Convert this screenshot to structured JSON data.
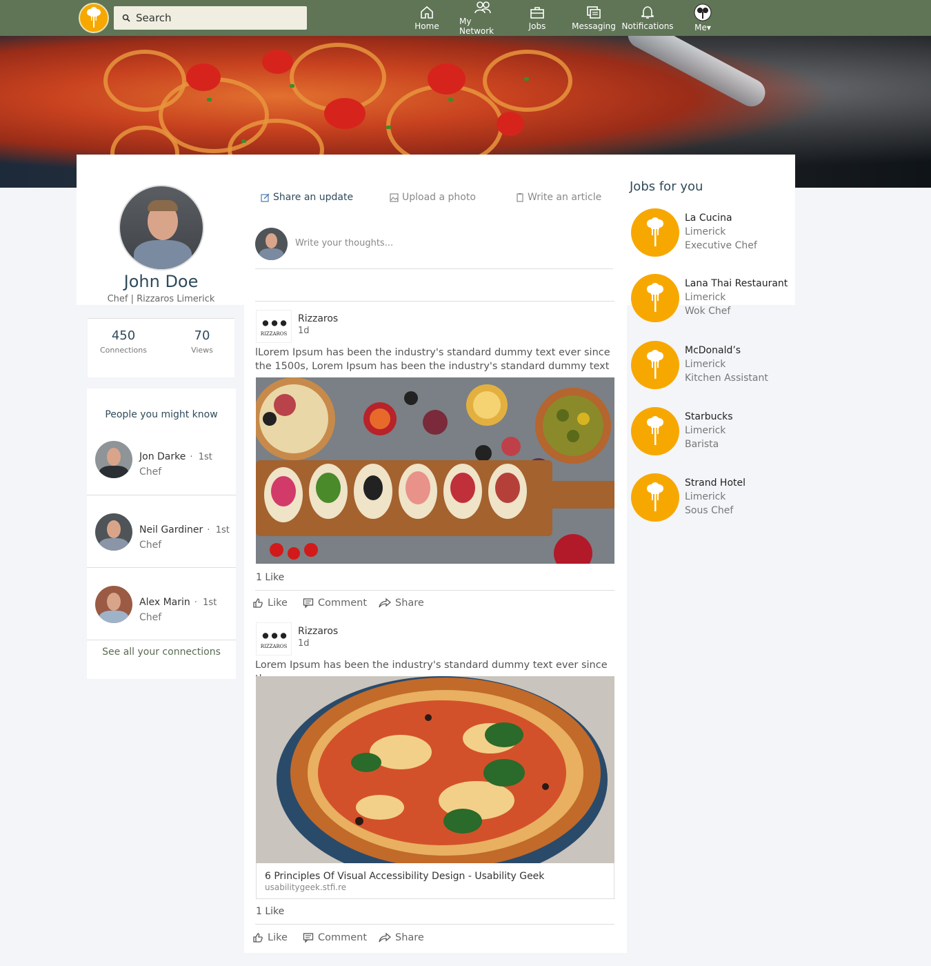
{
  "nav": {
    "search_placeholder": "Search",
    "items": [
      {
        "label": "Home",
        "icon": "home-icon"
      },
      {
        "label": "My Network",
        "icon": "network-icon"
      },
      {
        "label": "Jobs",
        "icon": "briefcase-icon"
      },
      {
        "label": "Messaging",
        "icon": "messaging-icon"
      },
      {
        "label": "Notifications",
        "icon": "bell-icon"
      },
      {
        "label": "Me",
        "icon": "avatar"
      }
    ]
  },
  "colors": {
    "nav_bg": "#5f7556",
    "accent": "#f7a800",
    "heading": "#2f4a5a"
  },
  "profile": {
    "name": "John Doe",
    "subtitle": "Chef | Rizzaros Limerick",
    "connections": "450",
    "connections_label": "Connections",
    "views": "70",
    "views_label": "Views"
  },
  "people": {
    "title": "People you might know",
    "items": [
      {
        "name": "Jon Darke",
        "degree": "1st",
        "role": "Chef"
      },
      {
        "name": "Neil Gardiner",
        "degree": "1st",
        "role": "Chef"
      },
      {
        "name": "Alex Marin",
        "degree": "1st",
        "role": "Chef"
      }
    ],
    "see_all": "See all your connections"
  },
  "composer": {
    "share_update": "Share an update",
    "upload_photo": "Upload a photo",
    "write_article": "Write an article",
    "placeholder": "Write your thoughts..."
  },
  "posts": [
    {
      "author": "Rizzaros",
      "logo_text": "RIZZAROS",
      "time": "1d",
      "text": "lLorem Ipsum has been the industry's standard dummy text ever since the 1500s,  Lorem Ipsum has been the industry's standard dummy text ever",
      "likes": "1 Like",
      "actions": {
        "like": "Like",
        "comment": "Comment",
        "share": "Share"
      }
    },
    {
      "author": "Rizzaros",
      "logo_text": "RIZZAROS",
      "time": "1d",
      "text": "Lorem Ipsum has been the industry's standard dummy text ever since the",
      "link_title": "6 Principles Of Visual Accessibility Design - Usability Geek",
      "link_url": "usabilitygeek.stfi.re",
      "likes": "1 Like",
      "actions": {
        "like": "Like",
        "comment": "Comment",
        "share": "Share"
      }
    }
  ],
  "jobs": {
    "title": "Jobs for you",
    "items": [
      {
        "name": "La Cucina",
        "location": "Limerick",
        "role": "Executive Chef"
      },
      {
        "name": "Lana Thai Restaurant",
        "location": "Limerick",
        "role": "Wok Chef"
      },
      {
        "name": "McDonald’s",
        "location": "Limerick",
        "role": "Kitchen Assistant"
      },
      {
        "name": "Starbucks",
        "location": "Limerick",
        "role": "Barista"
      },
      {
        "name": "Strand Hotel",
        "location": "Limerick",
        "role": "Sous Chef"
      }
    ]
  }
}
